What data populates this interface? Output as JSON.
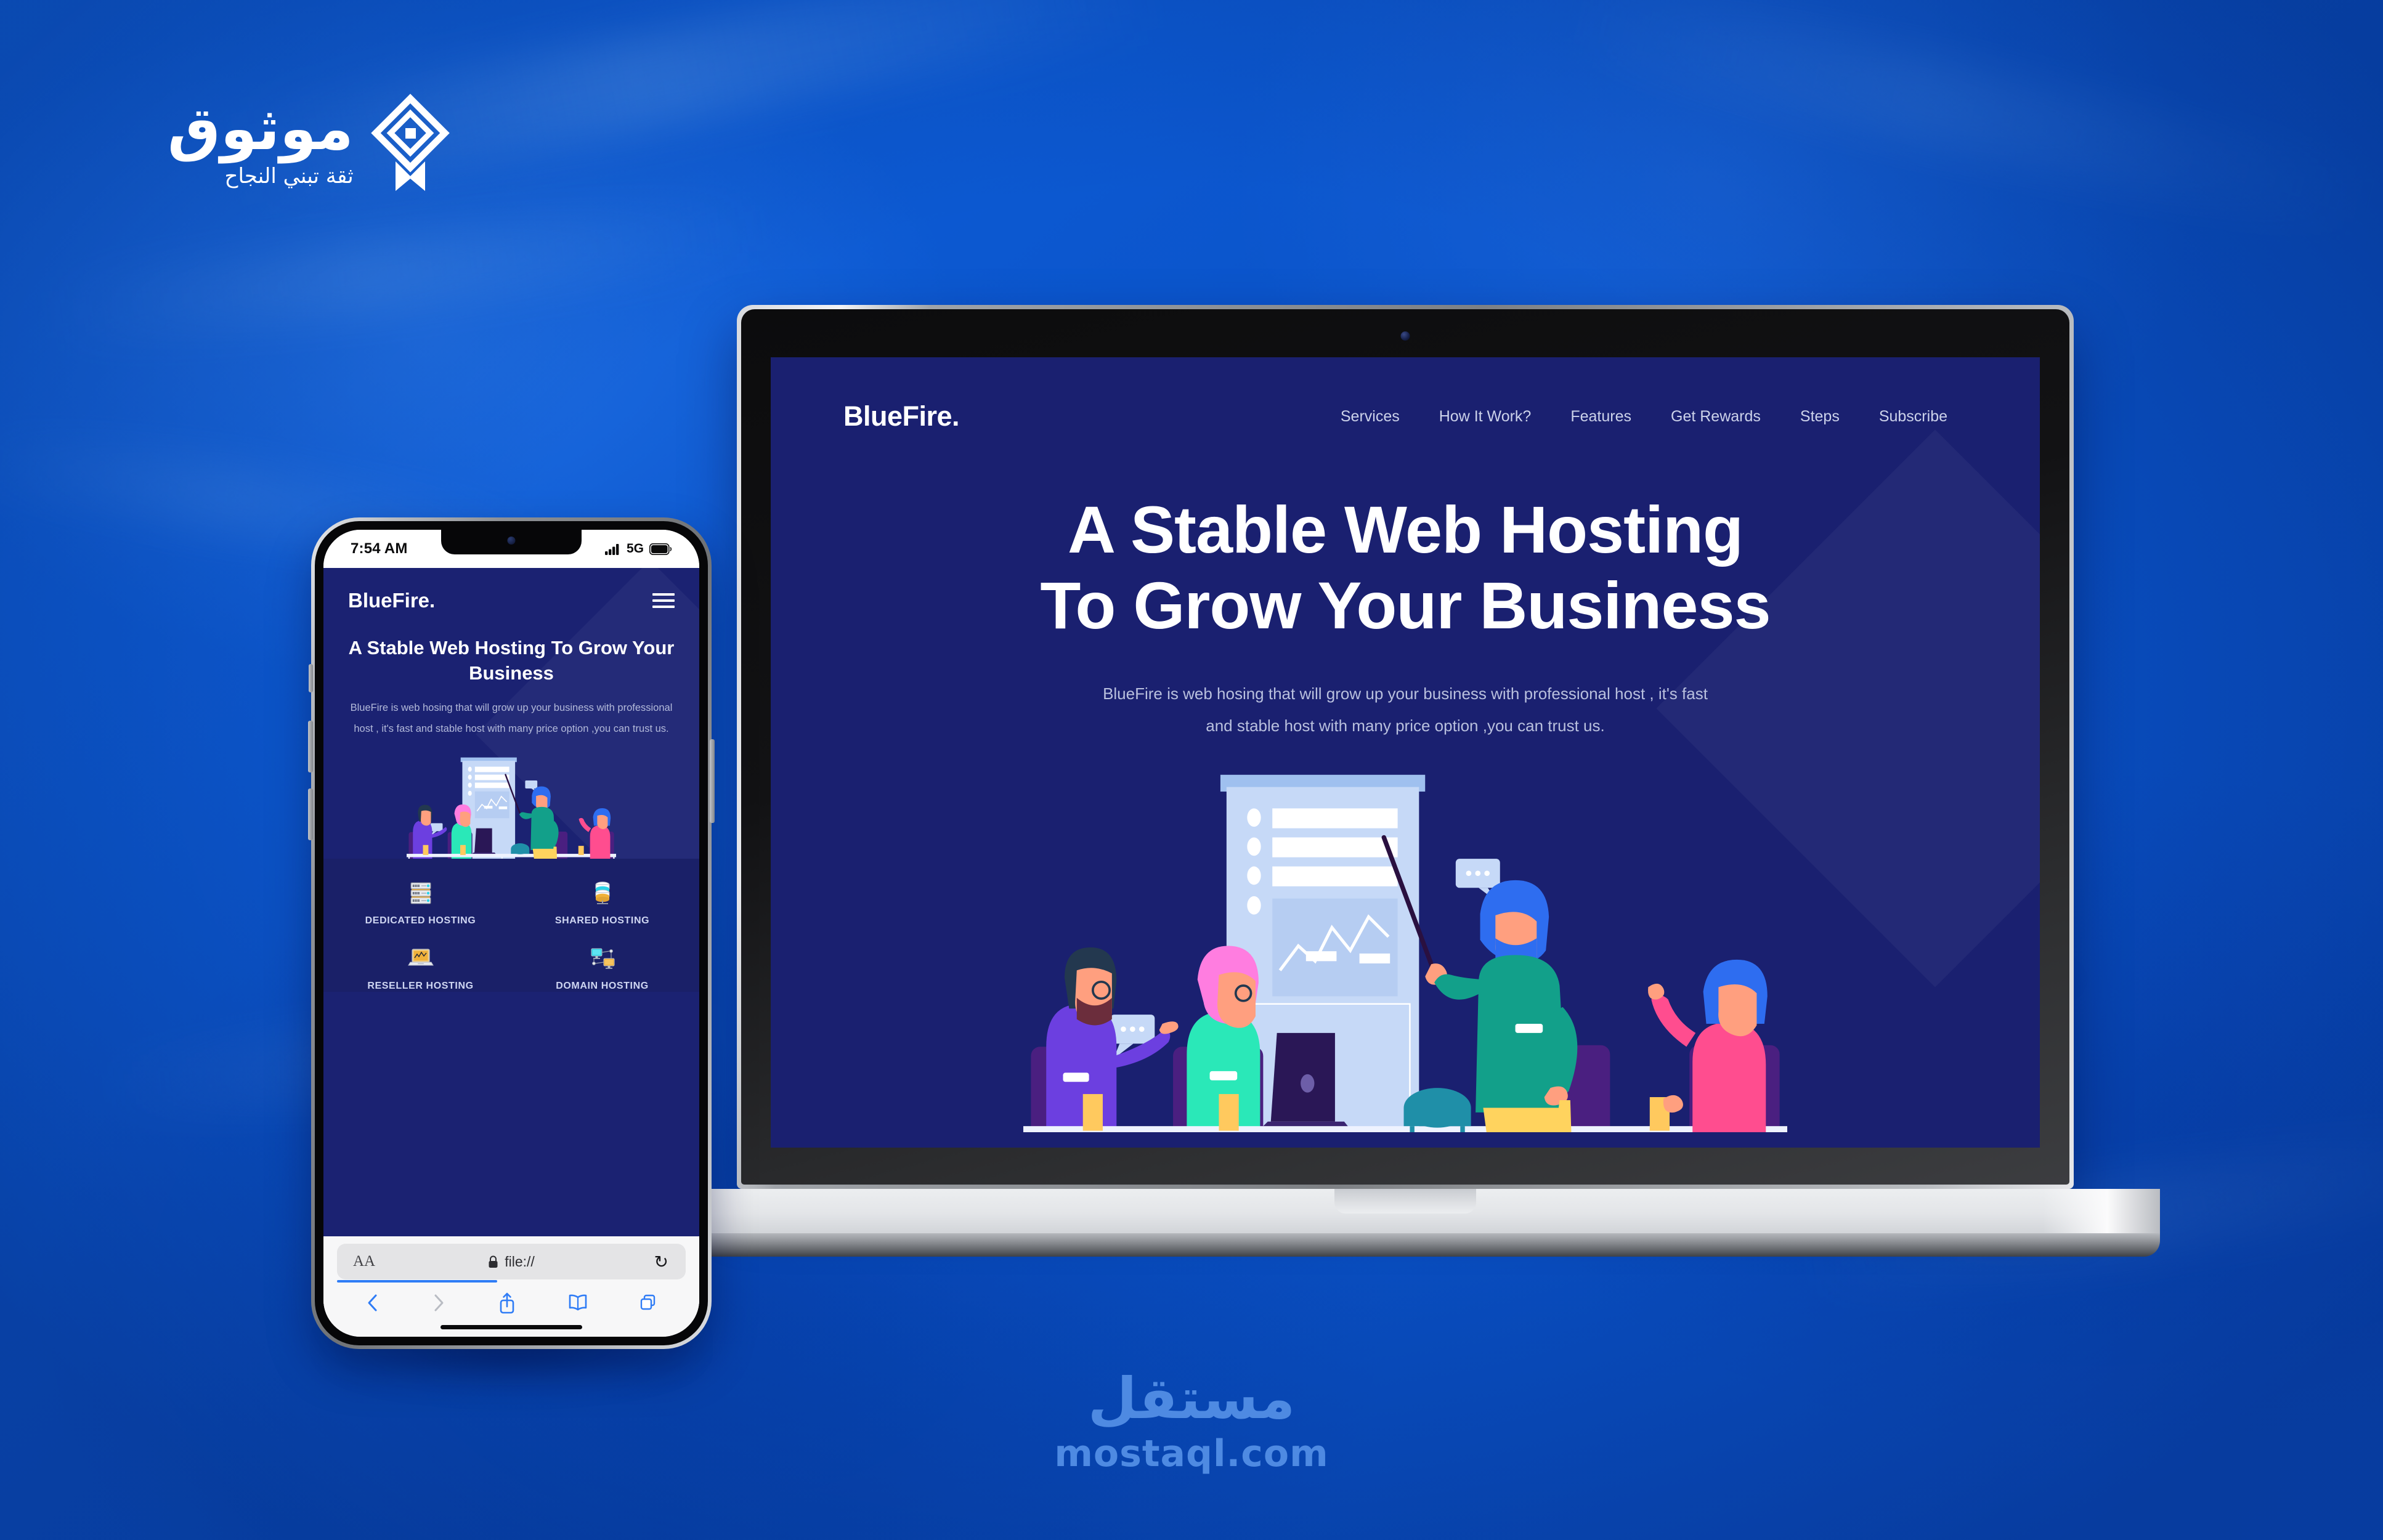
{
  "background": {
    "primary_color": "#0d5bd4",
    "accent_color": "#1a2070"
  },
  "watermark_logo": {
    "word": "موثوق",
    "tagline": "ثقة تبني النجاح",
    "mark_name": "diamond-layers-mark"
  },
  "footer_watermark": {
    "arabic": "مستقل",
    "domain": "mostaql.com",
    "color": "#4e8ae2"
  },
  "desktop": {
    "device": "laptop",
    "site": {
      "brand": "BlueFire.",
      "nav": [
        {
          "label": "Services"
        },
        {
          "label": "How It Work?"
        },
        {
          "label": "Features"
        },
        {
          "label": "Get Rewards"
        },
        {
          "label": "Steps"
        },
        {
          "label": "Subscribe"
        }
      ],
      "hero": {
        "headline_line1": "A Stable Web Hosting",
        "headline_line2": "To Grow Your Business",
        "paragraph_line1": "BlueFire is web hosing that will grow up your business with professional host , it's fast",
        "paragraph_line2": "and stable host with many price option ,you can trust us."
      }
    }
  },
  "mobile": {
    "device": "smartphone",
    "status_bar": {
      "time": "7:54 AM",
      "network": "5G",
      "signal_icon": "cellular-bars-icon",
      "battery_icon": "battery-full-icon"
    },
    "site": {
      "brand": "BlueFire.",
      "menu_icon": "hamburger-menu-icon",
      "hero": {
        "headline": "A Stable Web Hosting To Grow Your Business",
        "paragraph": "BlueFire is web hosing that will grow up your business with professional host , it's fast and stable host with many price option ,you can trust us."
      },
      "services": [
        {
          "label": "DEDICATED HOSTING",
          "icon": "server-rack-icon"
        },
        {
          "label": "SHARED HOSTING",
          "icon": "database-cylinder-icon"
        },
        {
          "label": "RESELLER HOSTING",
          "icon": "laptop-chart-icon"
        },
        {
          "label": "DOMAIN HOSTING",
          "icon": "network-monitors-icon"
        }
      ]
    },
    "browser": {
      "text_size_label": "AA",
      "lock_icon": "lock-icon",
      "url": "file://",
      "reload_icon": "reload-icon",
      "back_icon": "chevron-left-icon",
      "forward_icon": "chevron-right-icon",
      "share_icon": "share-icon",
      "bookmarks_icon": "book-icon",
      "tabs_icon": "tabs-icon"
    }
  },
  "illustration": {
    "name": "business-meeting-presentation",
    "description": "Four people seated at a table with a presenter pointing at a whiteboard chart"
  }
}
